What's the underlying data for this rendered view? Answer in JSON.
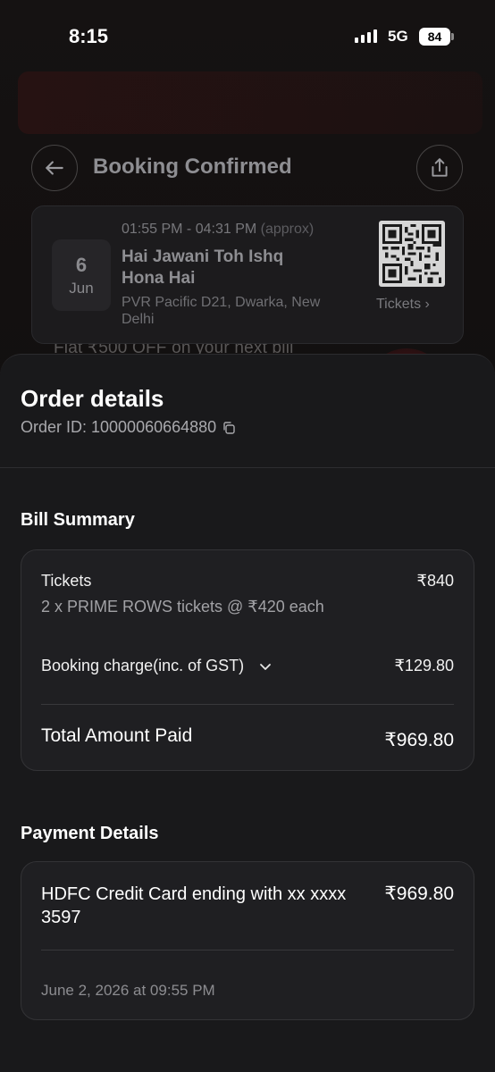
{
  "status_bar": {
    "time": "8:15",
    "network": "5G",
    "battery": "84"
  },
  "header": {
    "title": "Booking Confirmed",
    "back_icon": "arrow-left-icon",
    "share_icon": "share-icon"
  },
  "booking": {
    "date_day": "6",
    "date_month": "Jun",
    "showtime": "01:55 PM - 04:31 PM",
    "showtime_note": "(approx)",
    "movie_title": "Hai Jawani Toh Ishq Hona Hai",
    "venue": "PVR Pacific D21, Dwarka, New Delhi",
    "tickets_link": "Tickets ›"
  },
  "background": {
    "promo_text": "Flat ₹500 OFF on your next bill"
  },
  "order": {
    "title": "Order details",
    "order_id": "Order ID: 10000060664880"
  },
  "bill_summary": {
    "title": "Bill Summary",
    "tickets_label": "Tickets",
    "tickets_value": "₹840",
    "tickets_detail": "2 x PRIME ROWS tickets @ ₹420 each",
    "booking_charge_label": "Booking charge(inc. of GST)",
    "booking_charge_value": "₹129.80",
    "total_label": "Total Amount Paid",
    "total_value": "₹969.80"
  },
  "payment": {
    "title": "Payment Details",
    "method": "HDFC Credit Card ending with xx xxxx 3597",
    "amount": "₹969.80",
    "date": "June 2, 2026 at 09:55 PM"
  },
  "colors": {
    "background": "#0c0c0d",
    "sheet": "#19191b",
    "card": "#1f1f22"
  }
}
